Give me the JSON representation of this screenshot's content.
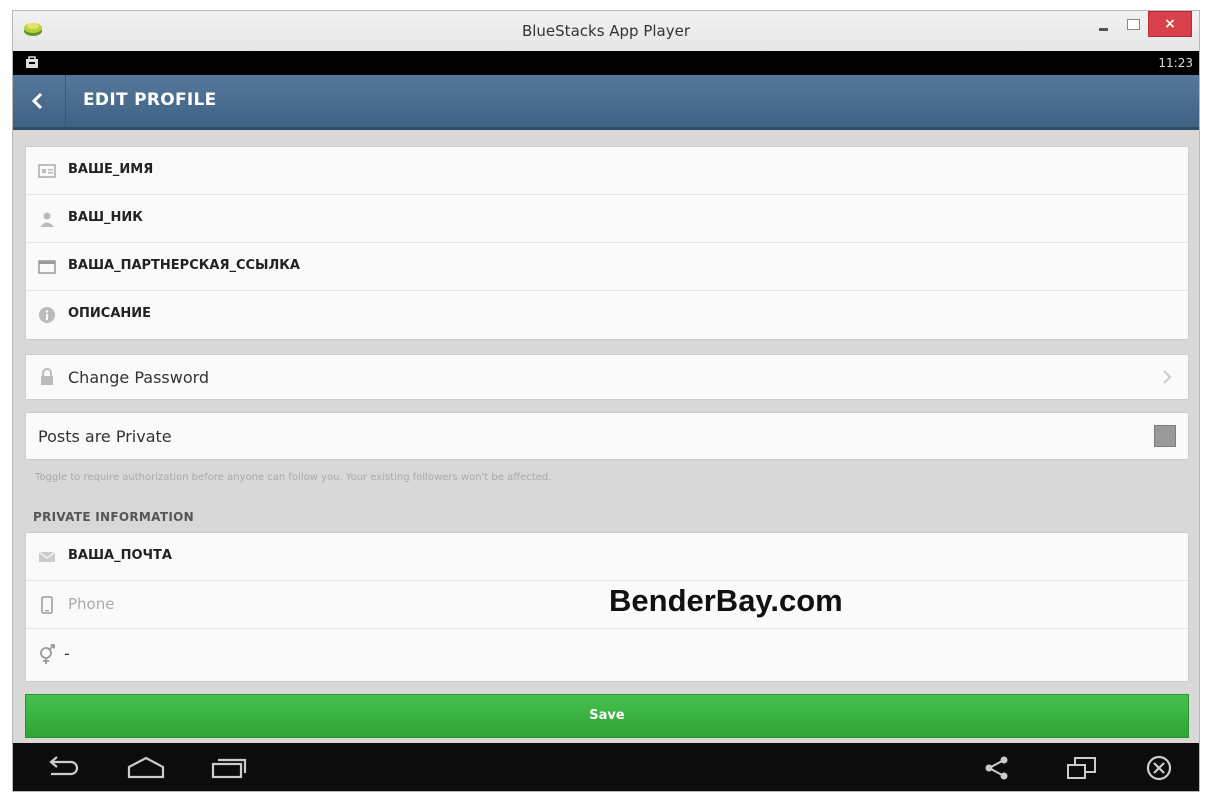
{
  "window": {
    "title": "BlueStacks App Player",
    "close_glyph": "×"
  },
  "status_bar": {
    "time": "11:23"
  },
  "action_bar": {
    "title": "EDIT PROFILE"
  },
  "profile_fields": [
    {
      "icon": "name-card-icon",
      "value": "ВАШЕ_ИМЯ"
    },
    {
      "icon": "user-icon",
      "value": "ВАШ_НИК"
    },
    {
      "icon": "browser-window-icon",
      "value": "ВАША_ПАРТНЕРСКАЯ_ССЫЛКА"
    },
    {
      "icon": "info-icon",
      "value": "ОПИСАНИЕ"
    }
  ],
  "password": {
    "label": "Change Password"
  },
  "privacy": {
    "label": "Posts are Private",
    "hint": "Toggle to require authorization before anyone can follow you. Your existing followers won't be affected."
  },
  "private_information": {
    "header": "PRIVATE INFORMATION",
    "email": "ВАША_ПОЧТА",
    "phone_placeholder": "Phone",
    "gender": "-"
  },
  "save_label": "Save",
  "watermark": "BenderBay.com",
  "colors": {
    "action_bar": "#4a6d90",
    "save_button": "#3bb443",
    "close_button": "#d9414a"
  }
}
